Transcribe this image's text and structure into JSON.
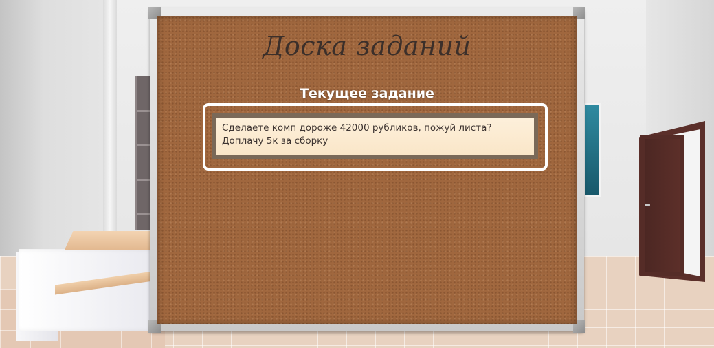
{
  "board": {
    "title": "Доска заданий",
    "section_label": "Текущее задание"
  },
  "current_task": {
    "line1": "Сделаете комп дороже 42000 рубликов, пожуй листа?",
    "line2": "Доплачу 5к за сборку"
  },
  "colors": {
    "cork": "#a0673e",
    "highlight_border": "#ffffff",
    "paper": "#fdf0db",
    "title_text": "#3b2f2a"
  }
}
